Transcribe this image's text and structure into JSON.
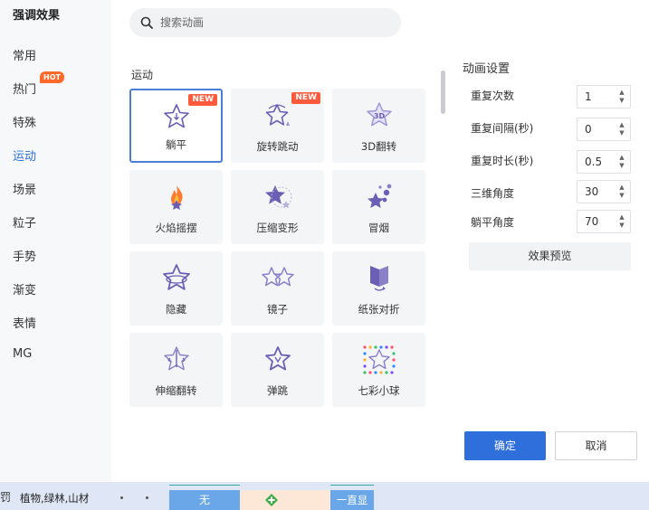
{
  "sidebar": {
    "title": "强调效果",
    "categories": [
      {
        "label": "常用"
      },
      {
        "label": "热门",
        "badge": "HOT"
      },
      {
        "label": "特殊"
      },
      {
        "label": "运动",
        "active": true
      },
      {
        "label": "场景"
      },
      {
        "label": "粒子"
      },
      {
        "label": "手势"
      },
      {
        "label": "渐变"
      },
      {
        "label": "表情"
      },
      {
        "label": "MG"
      }
    ]
  },
  "search": {
    "placeholder": "搜索动画",
    "icon": "search-icon"
  },
  "section": {
    "label": "运动"
  },
  "animations": [
    {
      "label": "躺平",
      "badge": "NEW",
      "selected": true,
      "icon": "star-lie-flat-icon"
    },
    {
      "label": "旋转跳动",
      "badge": "NEW",
      "icon": "star-spin-jump-icon"
    },
    {
      "label": "3D翻转",
      "icon": "star-3d-flip-icon"
    },
    {
      "label": "火焰摇摆",
      "icon": "flame-sway-icon"
    },
    {
      "label": "压缩变形",
      "icon": "star-compress-icon"
    },
    {
      "label": "冒烟",
      "icon": "smoke-icon"
    },
    {
      "label": "隐藏",
      "icon": "star-hide-icon"
    },
    {
      "label": "镜子",
      "icon": "star-mirror-icon"
    },
    {
      "label": "纸张对折",
      "icon": "paper-fold-icon"
    },
    {
      "label": "伸缩翻转",
      "icon": "star-stretch-flip-icon"
    },
    {
      "label": "弹跳",
      "icon": "star-bounce-icon"
    },
    {
      "label": "七彩小球",
      "icon": "rainbow-balls-icon"
    }
  ],
  "settings": {
    "title": "动画设置",
    "fields": [
      {
        "label": "重复次数",
        "value": "1"
      },
      {
        "label": "重复间隔(秒)",
        "value": "0"
      },
      {
        "label": "重复时长(秒)",
        "value": "0.5"
      },
      {
        "label": "三维角度",
        "value": "30"
      },
      {
        "label": "躺平角度",
        "value": "70"
      }
    ],
    "preview_label": "效果预览"
  },
  "footer": {
    "ok_label": "确定",
    "cancel_label": "取消"
  },
  "timeline": {
    "lead": "罚",
    "layer_name": "植物,绿林,山材",
    "none_label": "无",
    "always_label": "一直显"
  },
  "colors": {
    "accent": "#2f6fdb",
    "star": "#6b5fb5",
    "new_badge": "#ff5a3c",
    "hot_badge": "#ff6a2b"
  }
}
